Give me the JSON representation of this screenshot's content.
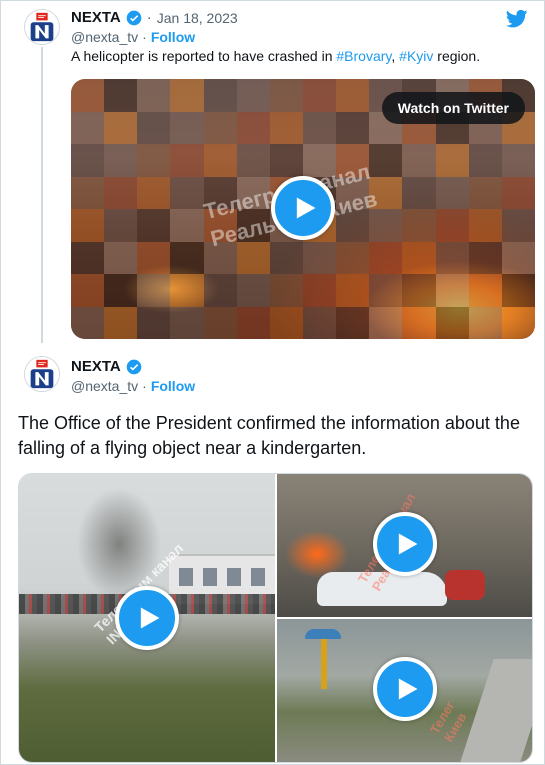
{
  "colors": {
    "accent": "#1d9bf0",
    "text": "#0f1419",
    "muted": "#536471",
    "border": "#cfd9de"
  },
  "quoted_tweet": {
    "author_name": "NEXTA",
    "date": "Jan 18, 2023",
    "handle": "@nexta_tv",
    "follow_label": "Follow",
    "text_prefix": "A helicopter is reported to have crashed in ",
    "hashtag1": "#Brovary",
    "separator": ", ",
    "hashtag2": "#Kyiv",
    "text_suffix": " region.",
    "media": {
      "watch_label": "Watch on Twitter",
      "watermark": "Телеграм канал\nРеальный Киев"
    }
  },
  "main_tweet": {
    "author_name": "NEXTA",
    "handle": "@nexta_tv",
    "follow_label": "Follow",
    "text": "The Office of the President confirmed the information about the falling of a flying object near a kindergarten.",
    "media": {
      "watermark_left": "Телеграмм канал\nINFO",
      "watermark_right_top": "Телеграм канал\nРеаль",
      "watermark_right_bottom": "Телег\nКиев"
    }
  },
  "icons": {
    "verified": "verified-badge-icon",
    "twitter": "twitter-bird-icon",
    "play": "play-icon"
  }
}
